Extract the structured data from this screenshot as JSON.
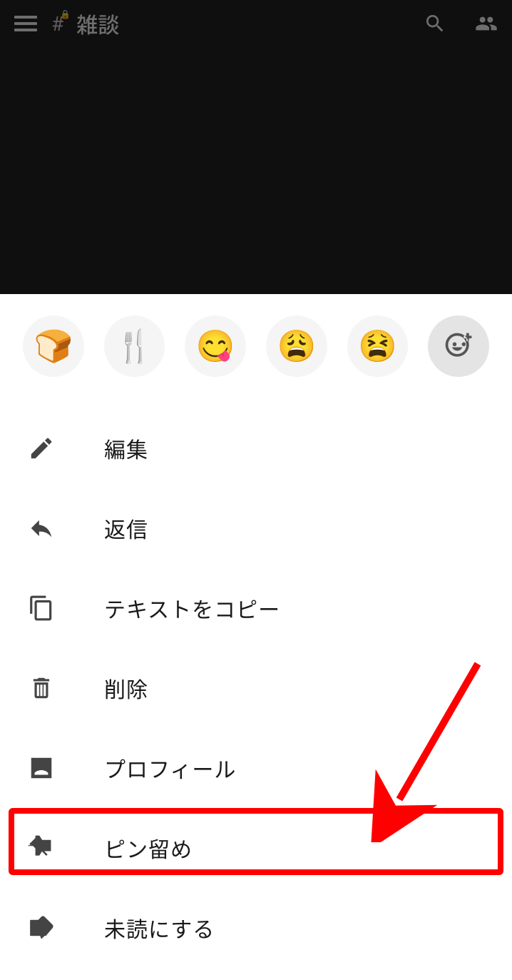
{
  "header": {
    "channel_title": "雑談"
  },
  "emojis": {
    "e1": "🍞",
    "e2": "🍴",
    "e3": "😋",
    "e4": "😩",
    "e5": "😫"
  },
  "menu": {
    "edit": "編集",
    "reply": "返信",
    "copy_text": "テキストをコピー",
    "delete": "削除",
    "profile": "プロフィール",
    "pin": "ピン留め",
    "mark_unread": "未読にする"
  }
}
